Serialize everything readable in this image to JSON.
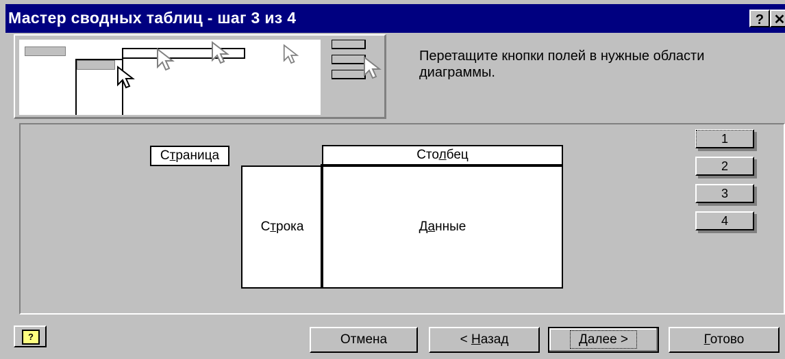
{
  "window": {
    "title": "Мастер сводных таблиц - шаг 3 из 4",
    "help_glyph": "?",
    "close_glyph": "✕"
  },
  "instruction": "Перетащите кнопки полей в нужные области диаграммы.",
  "layout": {
    "page": {
      "before": "С",
      "key": "т",
      "after": "раница"
    },
    "column": {
      "before": "Сто",
      "key": "л",
      "after": "бец"
    },
    "row": {
      "before": "С",
      "key": "т",
      "after": "рока"
    },
    "data": {
      "before": "Д",
      "key": "а",
      "after": "нные"
    }
  },
  "fields": [
    {
      "label": "1"
    },
    {
      "label": "2"
    },
    {
      "label": "3"
    },
    {
      "label": "4"
    }
  ],
  "buttons": {
    "help_glyph": "?",
    "cancel": "Отмена",
    "back": {
      "before": "< ",
      "key": "Н",
      "after": "азад"
    },
    "next": {
      "before": "",
      "key": "Д",
      "after": "алее >"
    },
    "finish": {
      "before": "",
      "key": "Г",
      "after": "отово"
    }
  }
}
